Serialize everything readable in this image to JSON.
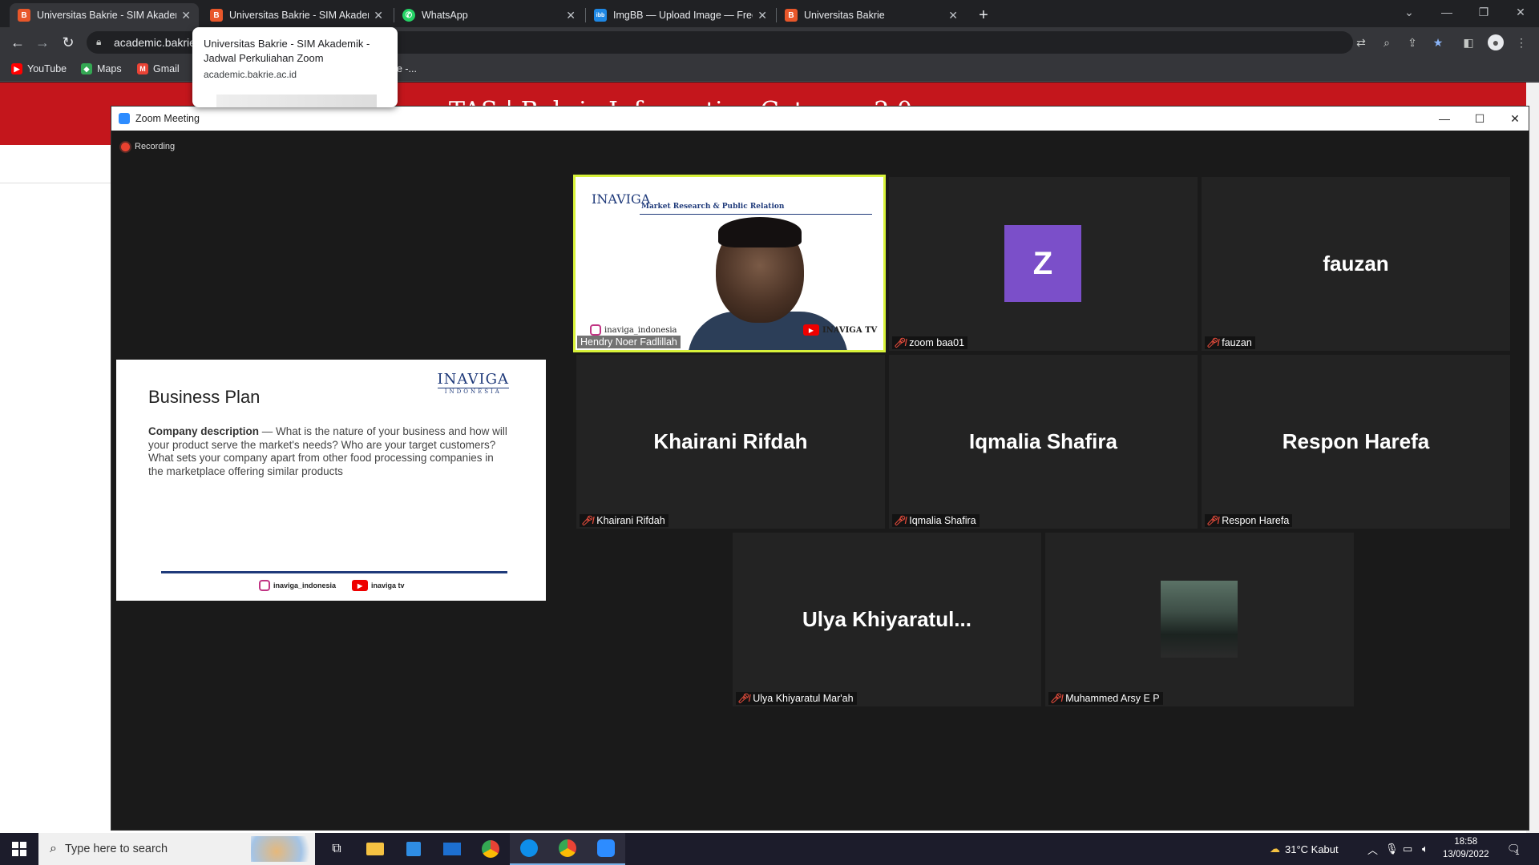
{
  "browser": {
    "tabs": [
      {
        "title": "Universitas Bakrie - SIM Akademik",
        "favicon": "B",
        "favicon_color": "#e8572a",
        "active": true
      },
      {
        "title": "Universitas Bakrie - SIM Akademik",
        "favicon": "B",
        "favicon_color": "#e8572a",
        "active": false
      },
      {
        "title": "WhatsApp",
        "favicon": "W",
        "favicon_color": "#25d366",
        "active": false
      },
      {
        "title": "ImgBB — Upload Image — Free",
        "favicon": "ibb",
        "favicon_color": "#1e88e5",
        "active": false
      },
      {
        "title": "Universitas Bakrie",
        "favicon": "B",
        "favicon_color": "#e8572a",
        "active": false
      }
    ],
    "new_tab_icon": "plus-icon",
    "url": "academic.bakrie",
    "bookmarks": [
      {
        "label": "YouTube",
        "icon_color": "#ff0000"
      },
      {
        "label": "Maps",
        "icon_color": "#34a853"
      },
      {
        "label": "Gmail",
        "icon_color": "#ea4335"
      }
    ],
    "bookmark_truncated": "rie -...",
    "tooltip": {
      "title": "Universitas Bakrie - SIM Akademik - Jadwal Perkuliahan Zoom",
      "url": "academic.bakrie.ac.id"
    }
  },
  "webpage": {
    "header_text": "TAS  |  Bakrie Information Gateway 2.0",
    "header_color": "#c4161c"
  },
  "zoom": {
    "window_title": "Zoom Meeting",
    "recording_label": "Recording",
    "slide": {
      "title": "Business Plan",
      "logo": "INAVIGA",
      "logo_sub": "INDONESIA",
      "body_bold": "Company description",
      "body_text": " — What is the nature of your business and how will your product serve the market's needs? Who are your target customers? What sets your company apart from other food processing companies in the marketplace offering similar products",
      "footer_ig": "inaviga_indonesia",
      "footer_yt": "inaviga tv"
    },
    "speaker": {
      "name": "Hendry Noer Fadlillah",
      "bg_logo": "INAVIGA",
      "bg_tag": "Market Research & Public Relation",
      "bg_ig": "inaviga_indonesia",
      "bg_yt": "INAVIGA TV",
      "highlight_color": "#d8f23a"
    },
    "participants": [
      {
        "display": "",
        "label": "zoom baa01",
        "avatar": "Z",
        "avatar_color": "#7b4fc9"
      },
      {
        "display": "fauzan",
        "label": "fauzan"
      },
      {
        "display": "Khairani Rifdah",
        "label": "Khairani Rifdah"
      },
      {
        "display": "Iqmalia Shafira",
        "label": "Iqmalia Shafira"
      },
      {
        "display": "Respon Harefa",
        "label": "Respon Harefa"
      },
      {
        "display": "Ulya  Khiyaratul...",
        "label": "Ulya Khiyaratul Mar'ah"
      },
      {
        "display": "",
        "label": "Muhammed Arsy E P",
        "photo": true
      }
    ]
  },
  "taskbar": {
    "search_placeholder": "Type here to search",
    "weather": "31°C  Kabut",
    "time": "18:58",
    "date": "13/09/2022",
    "notification_count": "1"
  }
}
